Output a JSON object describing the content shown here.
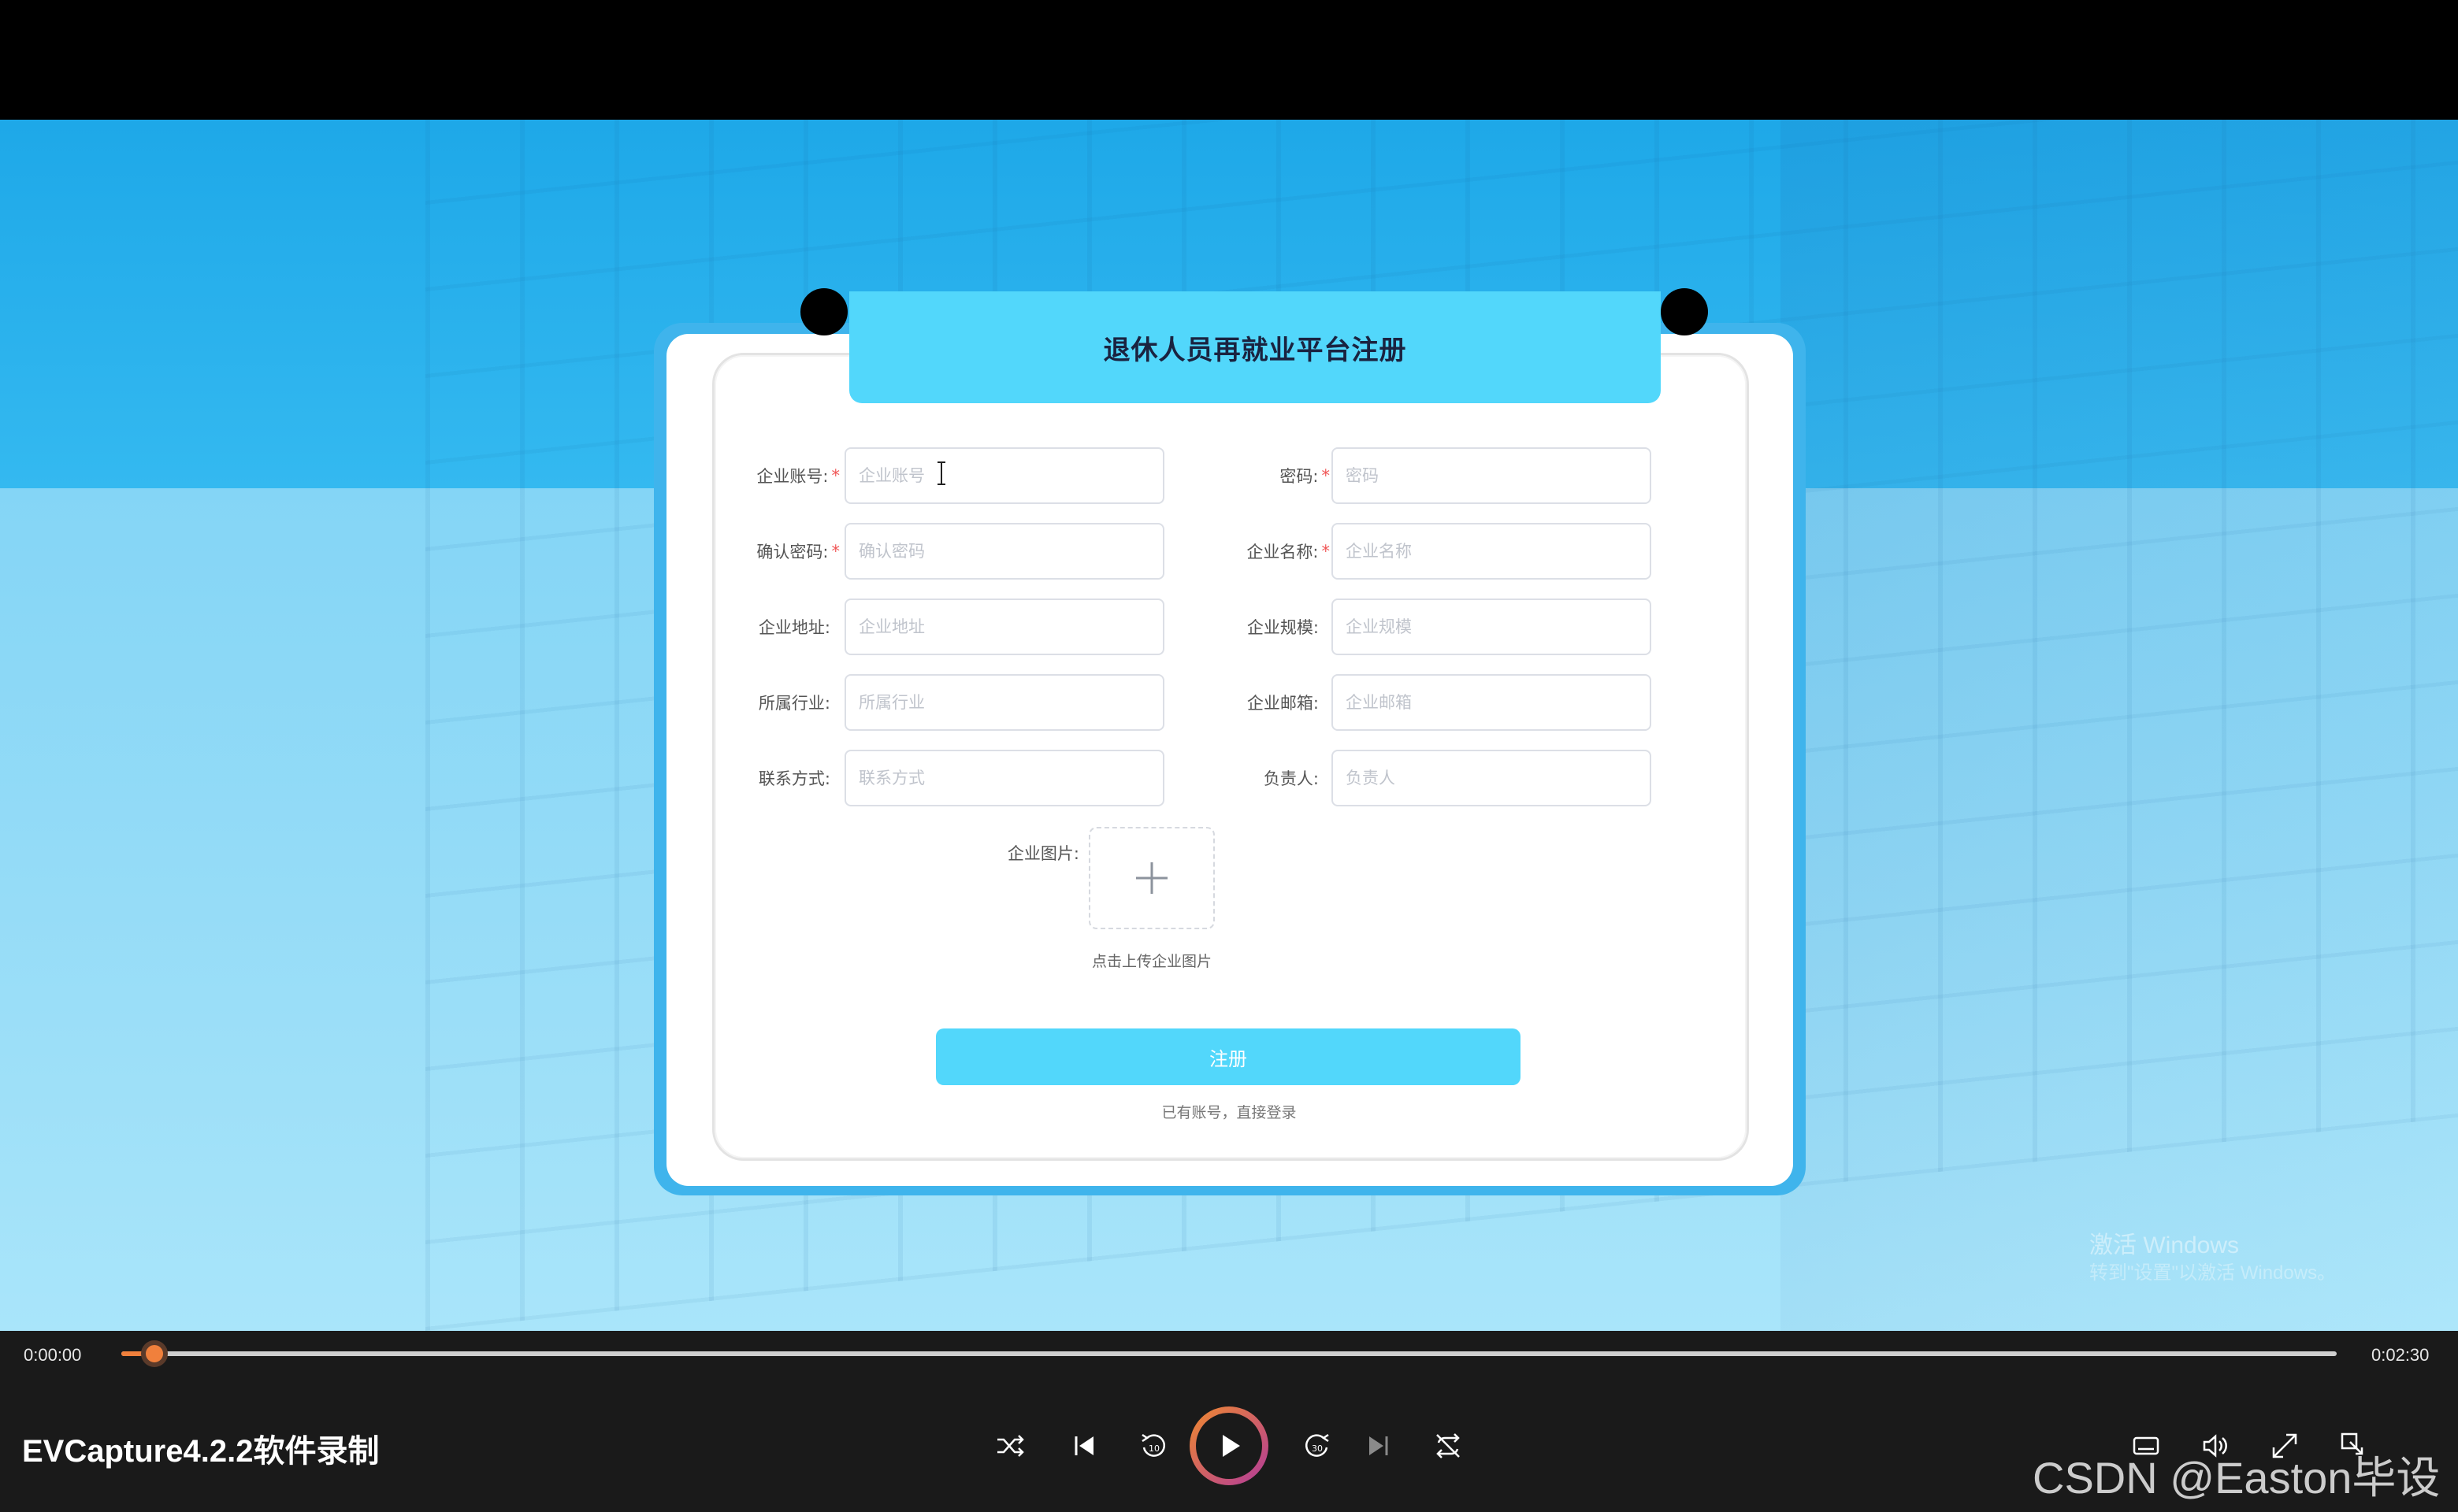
{
  "form": {
    "title": "退休人员再就业平台注册",
    "fields": [
      {
        "label": "企业账号:",
        "placeholder": "企业账号",
        "required": true
      },
      {
        "label": "密码:",
        "placeholder": "密码",
        "required": true
      },
      {
        "label": "确认密码:",
        "placeholder": "确认密码",
        "required": true
      },
      {
        "label": "企业名称:",
        "placeholder": "企业名称",
        "required": true
      },
      {
        "label": "企业地址:",
        "placeholder": "企业地址",
        "required": false
      },
      {
        "label": "企业规模:",
        "placeholder": "企业规模",
        "required": false
      },
      {
        "label": "所属行业:",
        "placeholder": "所属行业",
        "required": false
      },
      {
        "label": "企业邮箱:",
        "placeholder": "企业邮箱",
        "required": false
      },
      {
        "label": "联系方式:",
        "placeholder": "联系方式",
        "required": false
      },
      {
        "label": "负责人:",
        "placeholder": "负责人",
        "required": false
      }
    ],
    "required_mark": "*",
    "image_label": "企业图片:",
    "upload_hint": "点击上传企业图片",
    "submit_label": "注册",
    "login_link": "已有账号，直接登录"
  },
  "overlay": {
    "activate_windows": "激活 Windows",
    "activate_windows_sub": "转到\"设置\"以激活 Windows。"
  },
  "player": {
    "time_current": "0:00:00",
    "time_total": "0:02:30",
    "progress": 0.01,
    "app_title": "EVCapture4.2.2软件录制",
    "icons": [
      "shuffle-icon",
      "previous-icon",
      "rewind-10-icon",
      "play-icon",
      "forward-30-icon",
      "next-icon",
      "repeat-icon",
      "subtitles-icon",
      "volume-icon",
      "fullscreen-icon",
      "miniplayer-icon"
    ]
  },
  "watermark": "CSDN @Easton毕设",
  "colors": {
    "accent": "#52d7fb",
    "card_border": "#3fb4ec",
    "progress": "#f0803c"
  }
}
